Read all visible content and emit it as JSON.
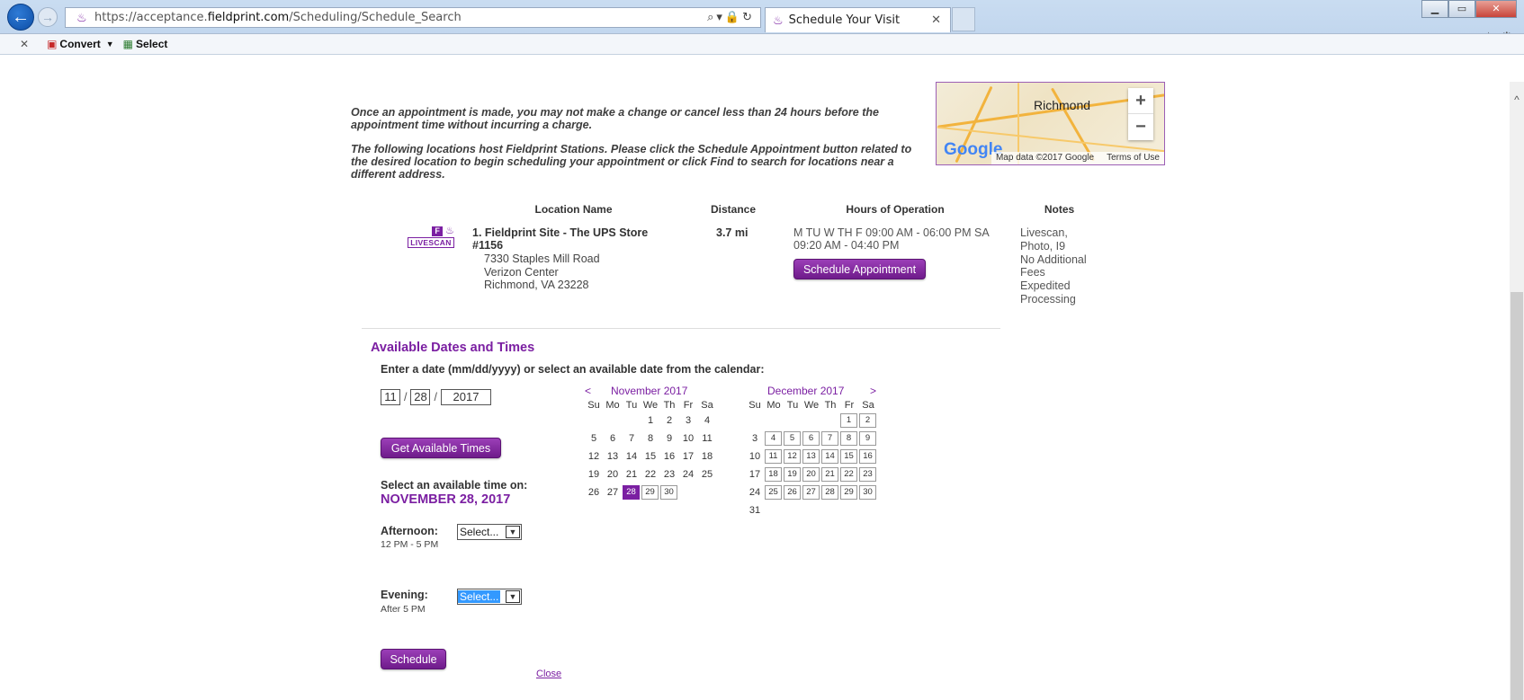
{
  "browser": {
    "url_prefix": "https://acceptance.",
    "url_domain": "fieldprint.com",
    "url_path": "/Scheduling/Schedule_Search",
    "tab_title": "Schedule Your Visit",
    "toolbar_convert": "Convert",
    "toolbar_select": "Select"
  },
  "notices": {
    "cancel_policy": "Once an appointment is made, you may not make a change or cancel less than 24 hours before the appointment time without incurring a charge.",
    "instructions": "The following locations host Fieldprint Stations. Please click the Schedule Appointment button related to the desired location to begin scheduling your appointment or click Find to search for locations near a different address."
  },
  "map": {
    "city": "Richmond",
    "zoom_in": "+",
    "zoom_out": "−",
    "logo": "Google",
    "map_data": "Map data ©2017 Google",
    "terms": "Terms of Use"
  },
  "table": {
    "headers": [
      "Location Name",
      "Distance",
      "Hours of Operation",
      "Notes"
    ],
    "badge_f": "F",
    "badge_livescan": "LIVESCAN",
    "location": {
      "name": "1. Fieldprint Site - The UPS Store #1156",
      "address_lines": [
        "7330 Staples Mill Road",
        "Verizon Center",
        "Richmond, VA 23228"
      ],
      "distance": "3.7 mi",
      "hours": "M TU W TH F 09:00 AM - 06:00 PM SA 09:20 AM - 04:40 PM",
      "schedule_button": "Schedule Appointment",
      "notes": [
        "Livescan,",
        "Photo, I9",
        "No Additional",
        "Fees",
        "Expedited",
        "Processing"
      ]
    }
  },
  "available": {
    "title": "Available Dates and Times",
    "instructions": "Enter a date (mm/dd/yyyy) or select an available date from the calendar:",
    "date_mm": "11",
    "date_dd": "28",
    "date_yyyy": "2017",
    "date_sep": "/",
    "get_times_button": "Get Available Times",
    "select_label": "Select an available time on:",
    "selected_date": "NOVEMBER 28, 2017",
    "afternoon_label": "Afternoon:",
    "afternoon_range": "12 PM - 5 PM",
    "afternoon_value": "Select...",
    "evening_label": "Evening:",
    "evening_range": "After 5 PM",
    "evening_value": "Select...",
    "schedule_button": "Schedule",
    "close_link": "Close"
  },
  "calendars": {
    "dow": [
      "Su",
      "Mo",
      "Tu",
      "We",
      "Th",
      "Fr",
      "Sa"
    ],
    "prev": "<",
    "next": ">",
    "november": {
      "title": "November 2017",
      "first_weekday": 3,
      "days": 30,
      "available": [
        28,
        29,
        30
      ],
      "selected": 28
    },
    "december": {
      "title": "December 2017",
      "first_weekday": 5,
      "days": 31,
      "available": [
        1,
        2,
        4,
        5,
        6,
        7,
        8,
        9,
        11,
        12,
        13,
        14,
        15,
        16,
        18,
        19,
        20,
        21,
        22,
        23,
        25,
        26,
        27,
        28,
        29,
        30
      ],
      "selected": null
    }
  }
}
